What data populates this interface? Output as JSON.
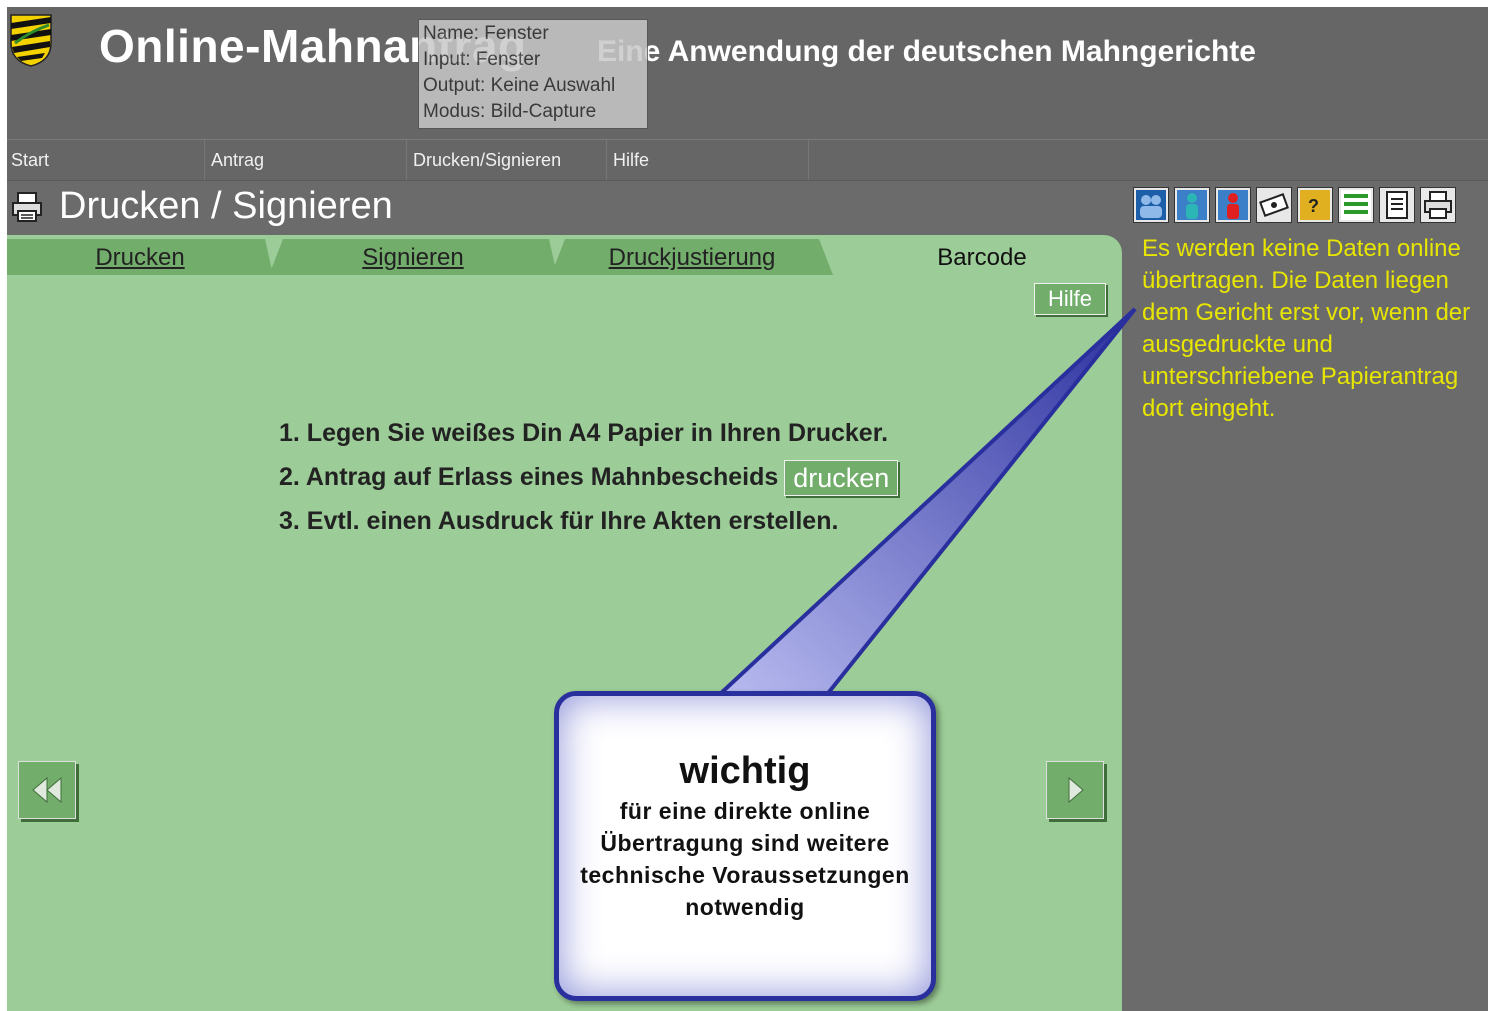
{
  "header": {
    "app_title": "Online-Mahnantrag",
    "app_subtitle": "Eine Anwendung der deutschen Mahngerichte"
  },
  "tooltip": {
    "name": "Name: Fenster",
    "input": "Input: Fenster",
    "output": "Output: Keine Auswahl",
    "mode": "Modus: Bild-Capture"
  },
  "menu": {
    "items": [
      {
        "label": "Start"
      },
      {
        "label": "Antrag"
      },
      {
        "label": "Drucken/Signieren"
      },
      {
        "label": "Hilfe"
      }
    ]
  },
  "page": {
    "title": "Drucken / Signieren"
  },
  "toolbar": {
    "icons": [
      "users-icon",
      "person-blue-icon",
      "person-red-icon",
      "certificate-icon",
      "help-icon",
      "list-icon",
      "document-icon",
      "printer-icon"
    ]
  },
  "tabs": [
    {
      "label": "Drucken",
      "active": false
    },
    {
      "label": "Signieren",
      "active": false
    },
    {
      "label": "Druckjustierung",
      "active": false
    },
    {
      "label": "Barcode",
      "active": true
    }
  ],
  "panel": {
    "help_label": "Hilfe",
    "steps": [
      "1. Legen Sie weißes Din A4 Papier in Ihren Drucker.",
      "2. Antrag auf Erlass eines Mahnbescheids",
      "3. Evtl. einen Ausdruck für Ihre Akten erstellen."
    ],
    "print_button": "drucken"
  },
  "callout": {
    "title": "wichtig",
    "text": "für eine direkte online Übertragung sind weitere technische Voraussetzungen notwendig"
  },
  "info_text": "Es werden keine Daten online übertragen. Die Daten liegen dem Gericht erst vor, wenn der ausgedruckte und unterschriebene Papierantrag dort eingeht."
}
